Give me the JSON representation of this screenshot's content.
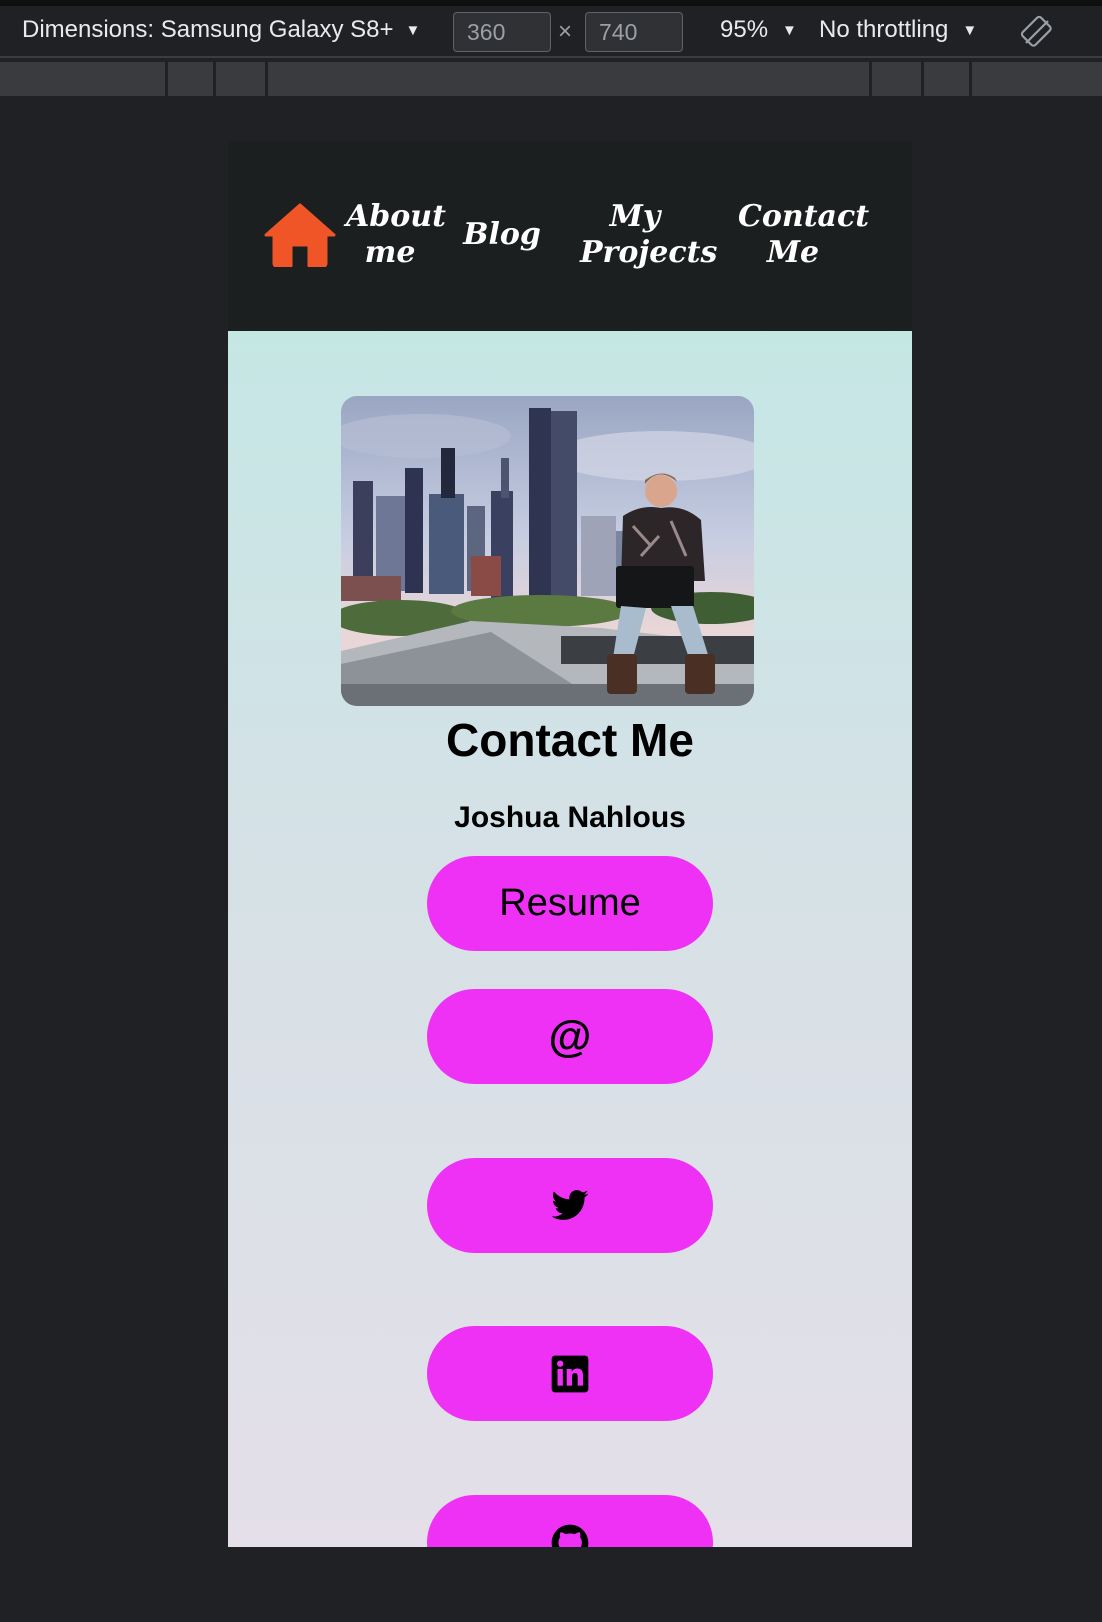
{
  "devtools": {
    "dimensions_label": "Dimensions: Samsung Galaxy S8+",
    "width": "360",
    "height": "740",
    "times": "×",
    "zoom": "95%",
    "throttling": "No throttling"
  },
  "nav": {
    "about": "About me",
    "blog": "Blog",
    "projects": "My Projects",
    "contact": "Contact Me"
  },
  "page": {
    "title": "Contact Me",
    "name": "Joshua Nahlous",
    "resume_label": "Resume",
    "email_symbol": "@"
  },
  "icons": {
    "home": "home-icon",
    "email": "at-icon",
    "twitter": "twitter-icon",
    "linkedin": "linkedin-icon",
    "github": "github-icon",
    "rotate": "rotate-icon"
  },
  "colors": {
    "nav_bg": "#1b1f1f",
    "home_icon": "#ef5527",
    "pill": "#ee31f5",
    "gradient_top": "#bfe9e4",
    "gradient_bottom": "#e4dfe8"
  }
}
